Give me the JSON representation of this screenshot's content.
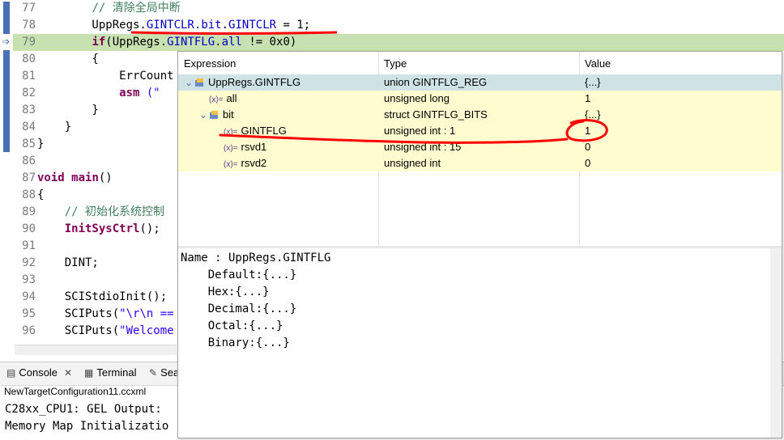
{
  "editor": {
    "lines": [
      {
        "n": "77",
        "parts": [
          {
            "t": "        ",
            "c": "tx"
          },
          {
            "t": "// 清除全局中断",
            "c": "cm"
          }
        ]
      },
      {
        "n": "78",
        "parts": [
          {
            "t": "        UppRegs.",
            "c": "tx"
          },
          {
            "t": "GINTCLR",
            "c": "fld"
          },
          {
            "t": ".",
            "c": "tx"
          },
          {
            "t": "bit",
            "c": "fld"
          },
          {
            "t": ".",
            "c": "tx"
          },
          {
            "t": "GINTCLR",
            "c": "fld"
          },
          {
            "t": " = 1;",
            "c": "tx"
          }
        ]
      },
      {
        "n": "79",
        "cur": true,
        "parts": [
          {
            "t": "        ",
            "c": "tx"
          },
          {
            "t": "if",
            "c": "kw"
          },
          {
            "t": "(UppRegs.",
            "c": "tx"
          },
          {
            "t": "GINTFLG",
            "c": "fld"
          },
          {
            "t": ".",
            "c": "tx"
          },
          {
            "t": "all",
            "c": "fld"
          },
          {
            "t": " != 0x0)",
            "c": "tx"
          }
        ]
      },
      {
        "n": "80",
        "parts": [
          {
            "t": "        {",
            "c": "tx"
          }
        ]
      },
      {
        "n": "81",
        "parts": [
          {
            "t": "            ErrCount",
            "c": "tx"
          }
        ]
      },
      {
        "n": "82",
        "parts": [
          {
            "t": "            ",
            "c": "tx"
          },
          {
            "t": "asm",
            "c": "kw"
          },
          {
            "t": " (\"",
            "c": "str"
          }
        ]
      },
      {
        "n": "83",
        "parts": [
          {
            "t": "        }",
            "c": "tx"
          }
        ]
      },
      {
        "n": "84",
        "parts": [
          {
            "t": "    }",
            "c": "tx"
          }
        ]
      },
      {
        "n": "85",
        "parts": [
          {
            "t": "}",
            "c": "tx"
          }
        ]
      },
      {
        "n": "86",
        "parts": []
      },
      {
        "n": "87",
        "parts": [
          {
            "t": "void",
            "c": "kw"
          },
          {
            "t": " ",
            "c": "tx"
          },
          {
            "t": "main",
            "c": "kw"
          },
          {
            "t": "()",
            "c": "tx"
          }
        ]
      },
      {
        "n": "88",
        "parts": [
          {
            "t": "{",
            "c": "tx"
          }
        ]
      },
      {
        "n": "89",
        "parts": [
          {
            "t": "    ",
            "c": "tx"
          },
          {
            "t": "// 初始化系统控制",
            "c": "cm"
          }
        ]
      },
      {
        "n": "90",
        "parts": [
          {
            "t": "    ",
            "c": "tx"
          },
          {
            "t": "InitSysCtrl",
            "c": "kw"
          },
          {
            "t": "();",
            "c": "tx"
          }
        ]
      },
      {
        "n": "91",
        "parts": []
      },
      {
        "n": "92",
        "parts": [
          {
            "t": "    DINT;",
            "c": "tx"
          }
        ]
      },
      {
        "n": "93",
        "parts": []
      },
      {
        "n": "94",
        "parts": [
          {
            "t": "    SCIStdioInit();",
            "c": "tx"
          }
        ]
      },
      {
        "n": "95",
        "parts": [
          {
            "t": "    SCIPuts(",
            "c": "tx"
          },
          {
            "t": "\"\\r\\n ==",
            "c": "str"
          }
        ]
      },
      {
        "n": "96",
        "parts": [
          {
            "t": "    SCIPuts(",
            "c": "tx"
          },
          {
            "t": "\"Welcome",
            "c": "str"
          }
        ]
      }
    ]
  },
  "console": {
    "tabs": [
      {
        "label": "Console",
        "icon": "console-icon"
      },
      {
        "label": "Terminal",
        "icon": "terminal-icon"
      },
      {
        "label": "Sea",
        "icon": "search-icon"
      }
    ],
    "config_name": "NewTargetConfiguration11.ccxml",
    "lines": [
      "C28xx_CPU1: GEL Output:",
      "Memory Map Initializatio"
    ]
  },
  "expressions": {
    "headers": {
      "expression": "Expression",
      "type": "Type",
      "value": "Value"
    },
    "rows": [
      {
        "name": "UppRegs.GINTFLG",
        "type": "union GINTFLG_REG",
        "value": "{...}",
        "level": 0,
        "expanded": true,
        "kind": "struct",
        "style": "sel"
      },
      {
        "name": "all",
        "type": "unsigned long",
        "value": "1",
        "level": 1,
        "kind": "var",
        "style": "yellow"
      },
      {
        "name": "bit",
        "type": "struct GINTFLG_BITS",
        "value": "{...}",
        "level": 1,
        "expanded": true,
        "kind": "struct",
        "style": "yellow"
      },
      {
        "name": "GINTFLG",
        "type": "unsigned int : 1",
        "value": "1",
        "level": 2,
        "kind": "var",
        "style": "yellow"
      },
      {
        "name": "rsvd1",
        "type": "unsigned int : 15",
        "value": "0",
        "level": 2,
        "kind": "var",
        "style": "yellow"
      },
      {
        "name": "rsvd2",
        "type": "unsigned int",
        "value": "0",
        "level": 2,
        "kind": "var",
        "style": "yellow"
      }
    ],
    "detail": [
      "Name : UppRegs.GINTFLG",
      "    Default:{...}",
      "    Hex:{...}",
      "    Decimal:{...}",
      "    Octal:{...}",
      "    Binary:{...}"
    ]
  },
  "colors": {
    "annotation": "#ff0000",
    "current_line": "#c7e1b0",
    "selected_row": "#cfe3e6",
    "changed_row": "#fffdd0"
  }
}
